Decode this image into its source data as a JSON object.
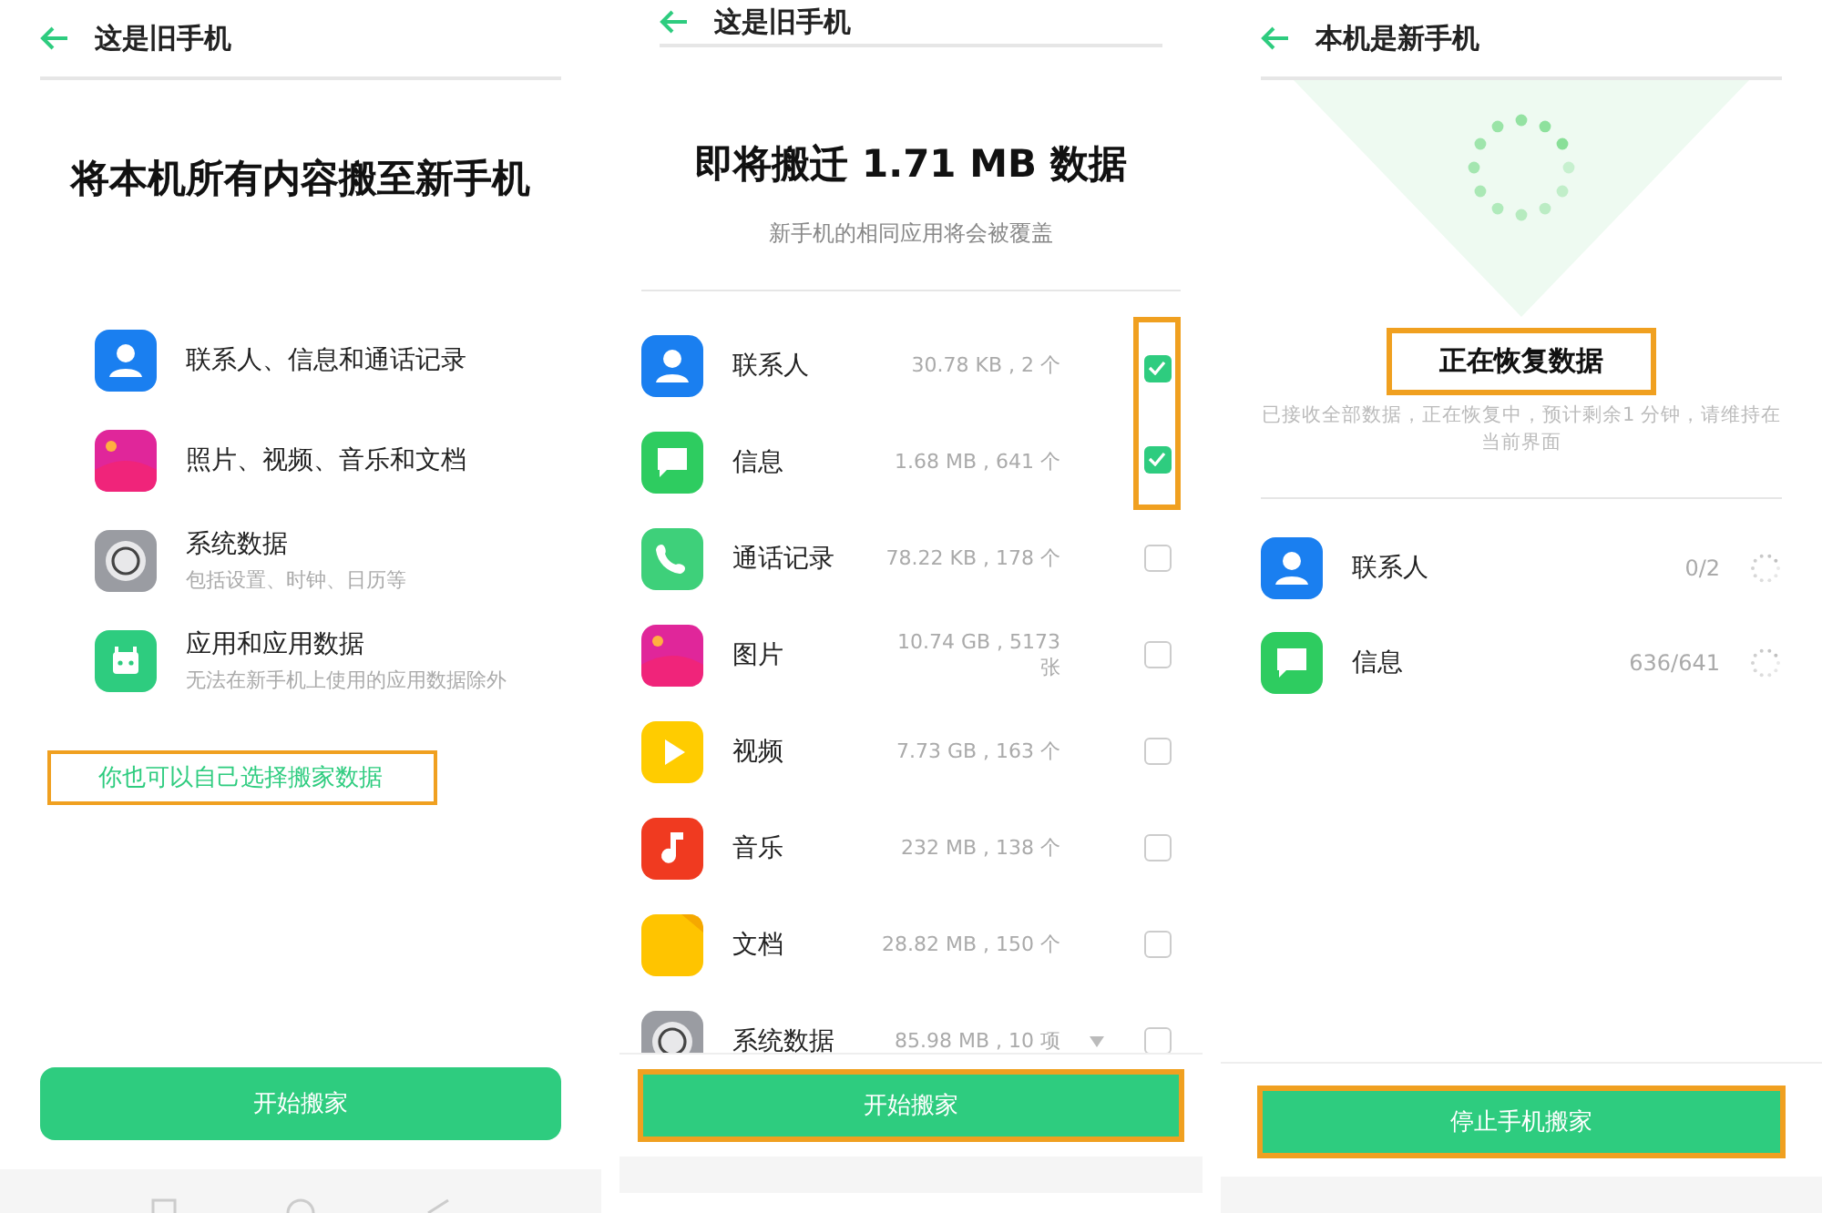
{
  "panels": [
    {
      "kind": "overview",
      "header": {
        "title": "这是旧手机"
      },
      "heading": "将本机所有内容搬至新手机",
      "items": [
        {
          "kind": "contacts",
          "label": "联系人、信息和通话记录"
        },
        {
          "kind": "photos",
          "label": "照片、视频、音乐和文档"
        },
        {
          "kind": "system",
          "label": "系统数据",
          "note": "包括设置、时钟、日历等"
        },
        {
          "kind": "apps",
          "label": "应用和应用数据",
          "note": "无法在新手机上使用的应用数据除外"
        }
      ],
      "link": {
        "text": "你也可以自己选择搬家数据",
        "annotated": true
      },
      "button": {
        "label": "开始搬家",
        "annotated": false
      },
      "nav_bar": true
    },
    {
      "kind": "select",
      "header": {
        "title": "这是旧手机"
      },
      "heading": "即将搬迁 1.71 MB 数据",
      "subheading": "新手机的相同应用将会被覆盖",
      "items": [
        {
          "kind": "contacts",
          "label": "联系人",
          "size": "30.78 KB , 2 个",
          "checked": true,
          "annotated": true
        },
        {
          "kind": "messages",
          "label": "信息",
          "size": "1.68 MB , 641 个",
          "checked": true,
          "annotated": true
        },
        {
          "kind": "phone",
          "label": "通话记录",
          "size": "78.22 KB , 178 个",
          "checked": false
        },
        {
          "kind": "photos",
          "label": "图片",
          "size": "10.74 GB , 5173 张",
          "checked": false
        },
        {
          "kind": "video",
          "label": "视频",
          "size": "7.73 GB , 163 个",
          "checked": false
        },
        {
          "kind": "music",
          "label": "音乐",
          "size": "232 MB , 138 个",
          "checked": false
        },
        {
          "kind": "docs",
          "label": "文档",
          "size": "28.82 MB , 150 个",
          "checked": false
        },
        {
          "kind": "system",
          "label": "系统数据",
          "size": "85.98 MB , 10 项",
          "checked": false,
          "expandable": true
        }
      ],
      "button": {
        "label": "开始搬家",
        "annotated": true
      }
    },
    {
      "kind": "progress",
      "header": {
        "title": "本机是新手机"
      },
      "status": {
        "text": "正在恢复数据",
        "annotated": true
      },
      "description": "已接收全部数据，正在恢复中，预计剩余1 分钟，请维持在当前界面",
      "items": [
        {
          "kind": "contacts",
          "label": "联系人",
          "count": "0/2"
        },
        {
          "kind": "messages",
          "label": "信息",
          "count": "636/641"
        }
      ],
      "button": {
        "label": "停止手机搬家",
        "annotated": true
      }
    }
  ]
}
